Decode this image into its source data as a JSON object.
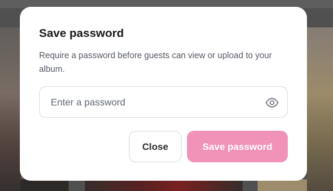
{
  "dialog": {
    "title": "Save password",
    "description": "Require a password before guests can view or upload to your album."
  },
  "password_field": {
    "placeholder": "Enter a password",
    "value": ""
  },
  "buttons": {
    "close_label": "Close",
    "save_label": "Save password"
  },
  "icons": {
    "visibility_toggle": "eye-icon"
  },
  "colors": {
    "primary_disabled": "#f192b8",
    "border": "#dcdfe4"
  }
}
